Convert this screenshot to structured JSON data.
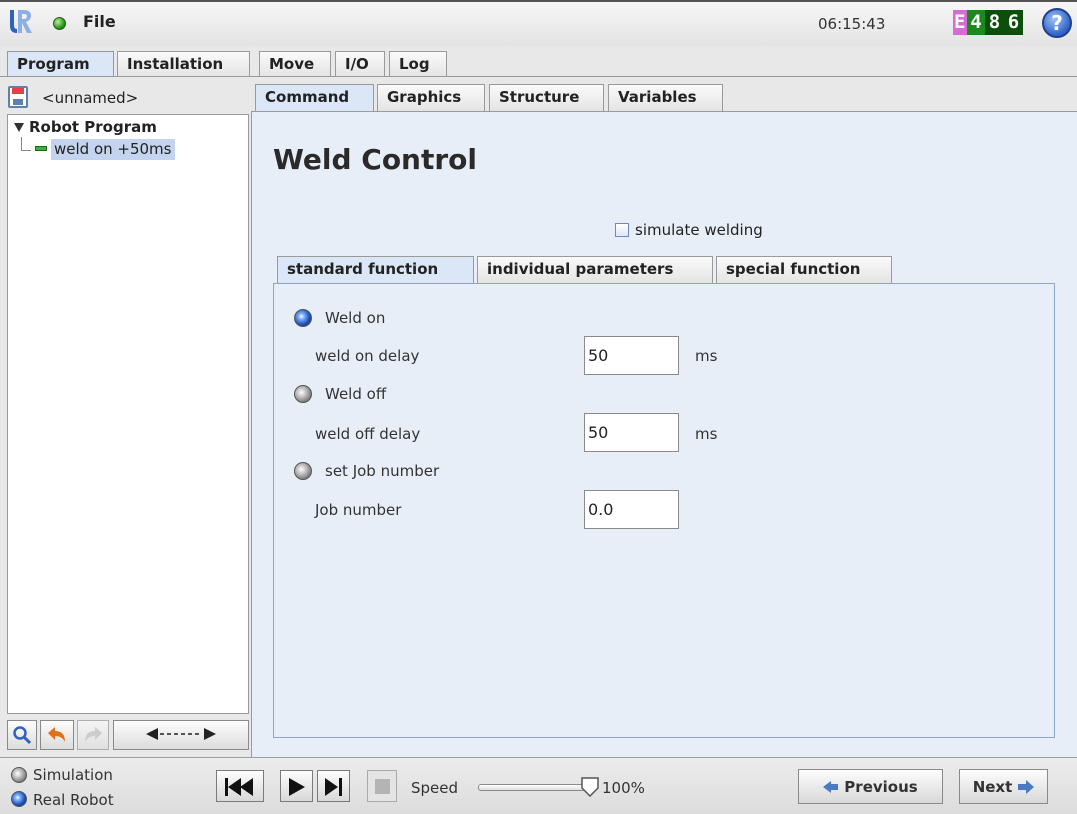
{
  "header": {
    "file_menu": "File",
    "clock": "06:15:43",
    "error_code": [
      "E",
      "4",
      "8",
      "6"
    ],
    "help": "?"
  },
  "main_tabs": [
    {
      "label": "Program",
      "active": true
    },
    {
      "label": "Installation",
      "active": false
    },
    {
      "label": "Move",
      "active": false
    },
    {
      "label": "I/O",
      "active": false
    },
    {
      "label": "Log",
      "active": false
    }
  ],
  "program": {
    "name": "<unnamed>",
    "tree_root": "Robot Program",
    "tree_item": "weld on +50ms"
  },
  "sub_tabs": [
    {
      "label": "Command",
      "active": true
    },
    {
      "label": "Graphics",
      "active": false
    },
    {
      "label": "Structure",
      "active": false
    },
    {
      "label": "Variables",
      "active": false
    }
  ],
  "weld": {
    "title": "Weld Control",
    "simulate_label": "simulate welding",
    "simulate_checked": false,
    "inner_tabs": [
      {
        "label": "standard function",
        "active": true
      },
      {
        "label": "individual parameters",
        "active": false
      },
      {
        "label": "special function",
        "active": false
      }
    ],
    "weld_on": {
      "label": "Weld on",
      "selected": true
    },
    "weld_on_delay": {
      "label": "weld on delay",
      "value": "50",
      "unit": "ms"
    },
    "weld_off": {
      "label": "Weld off",
      "selected": false
    },
    "weld_off_delay": {
      "label": "weld off delay",
      "value": "50",
      "unit": "ms"
    },
    "set_job": {
      "label": "set Job number",
      "selected": false
    },
    "job_number": {
      "label": "Job number",
      "value": "0.0"
    }
  },
  "bottom": {
    "simulation": "Simulation",
    "real_robot": "Real Robot",
    "speed_label": "Speed",
    "speed_value": "100%",
    "speed_fraction": 1.0,
    "previous": "Previous",
    "next": "Next"
  },
  "colors": {
    "accent_blue": "#2f62c8",
    "status_green": "#2a9a1a",
    "error_pink": "#d66ad6"
  }
}
